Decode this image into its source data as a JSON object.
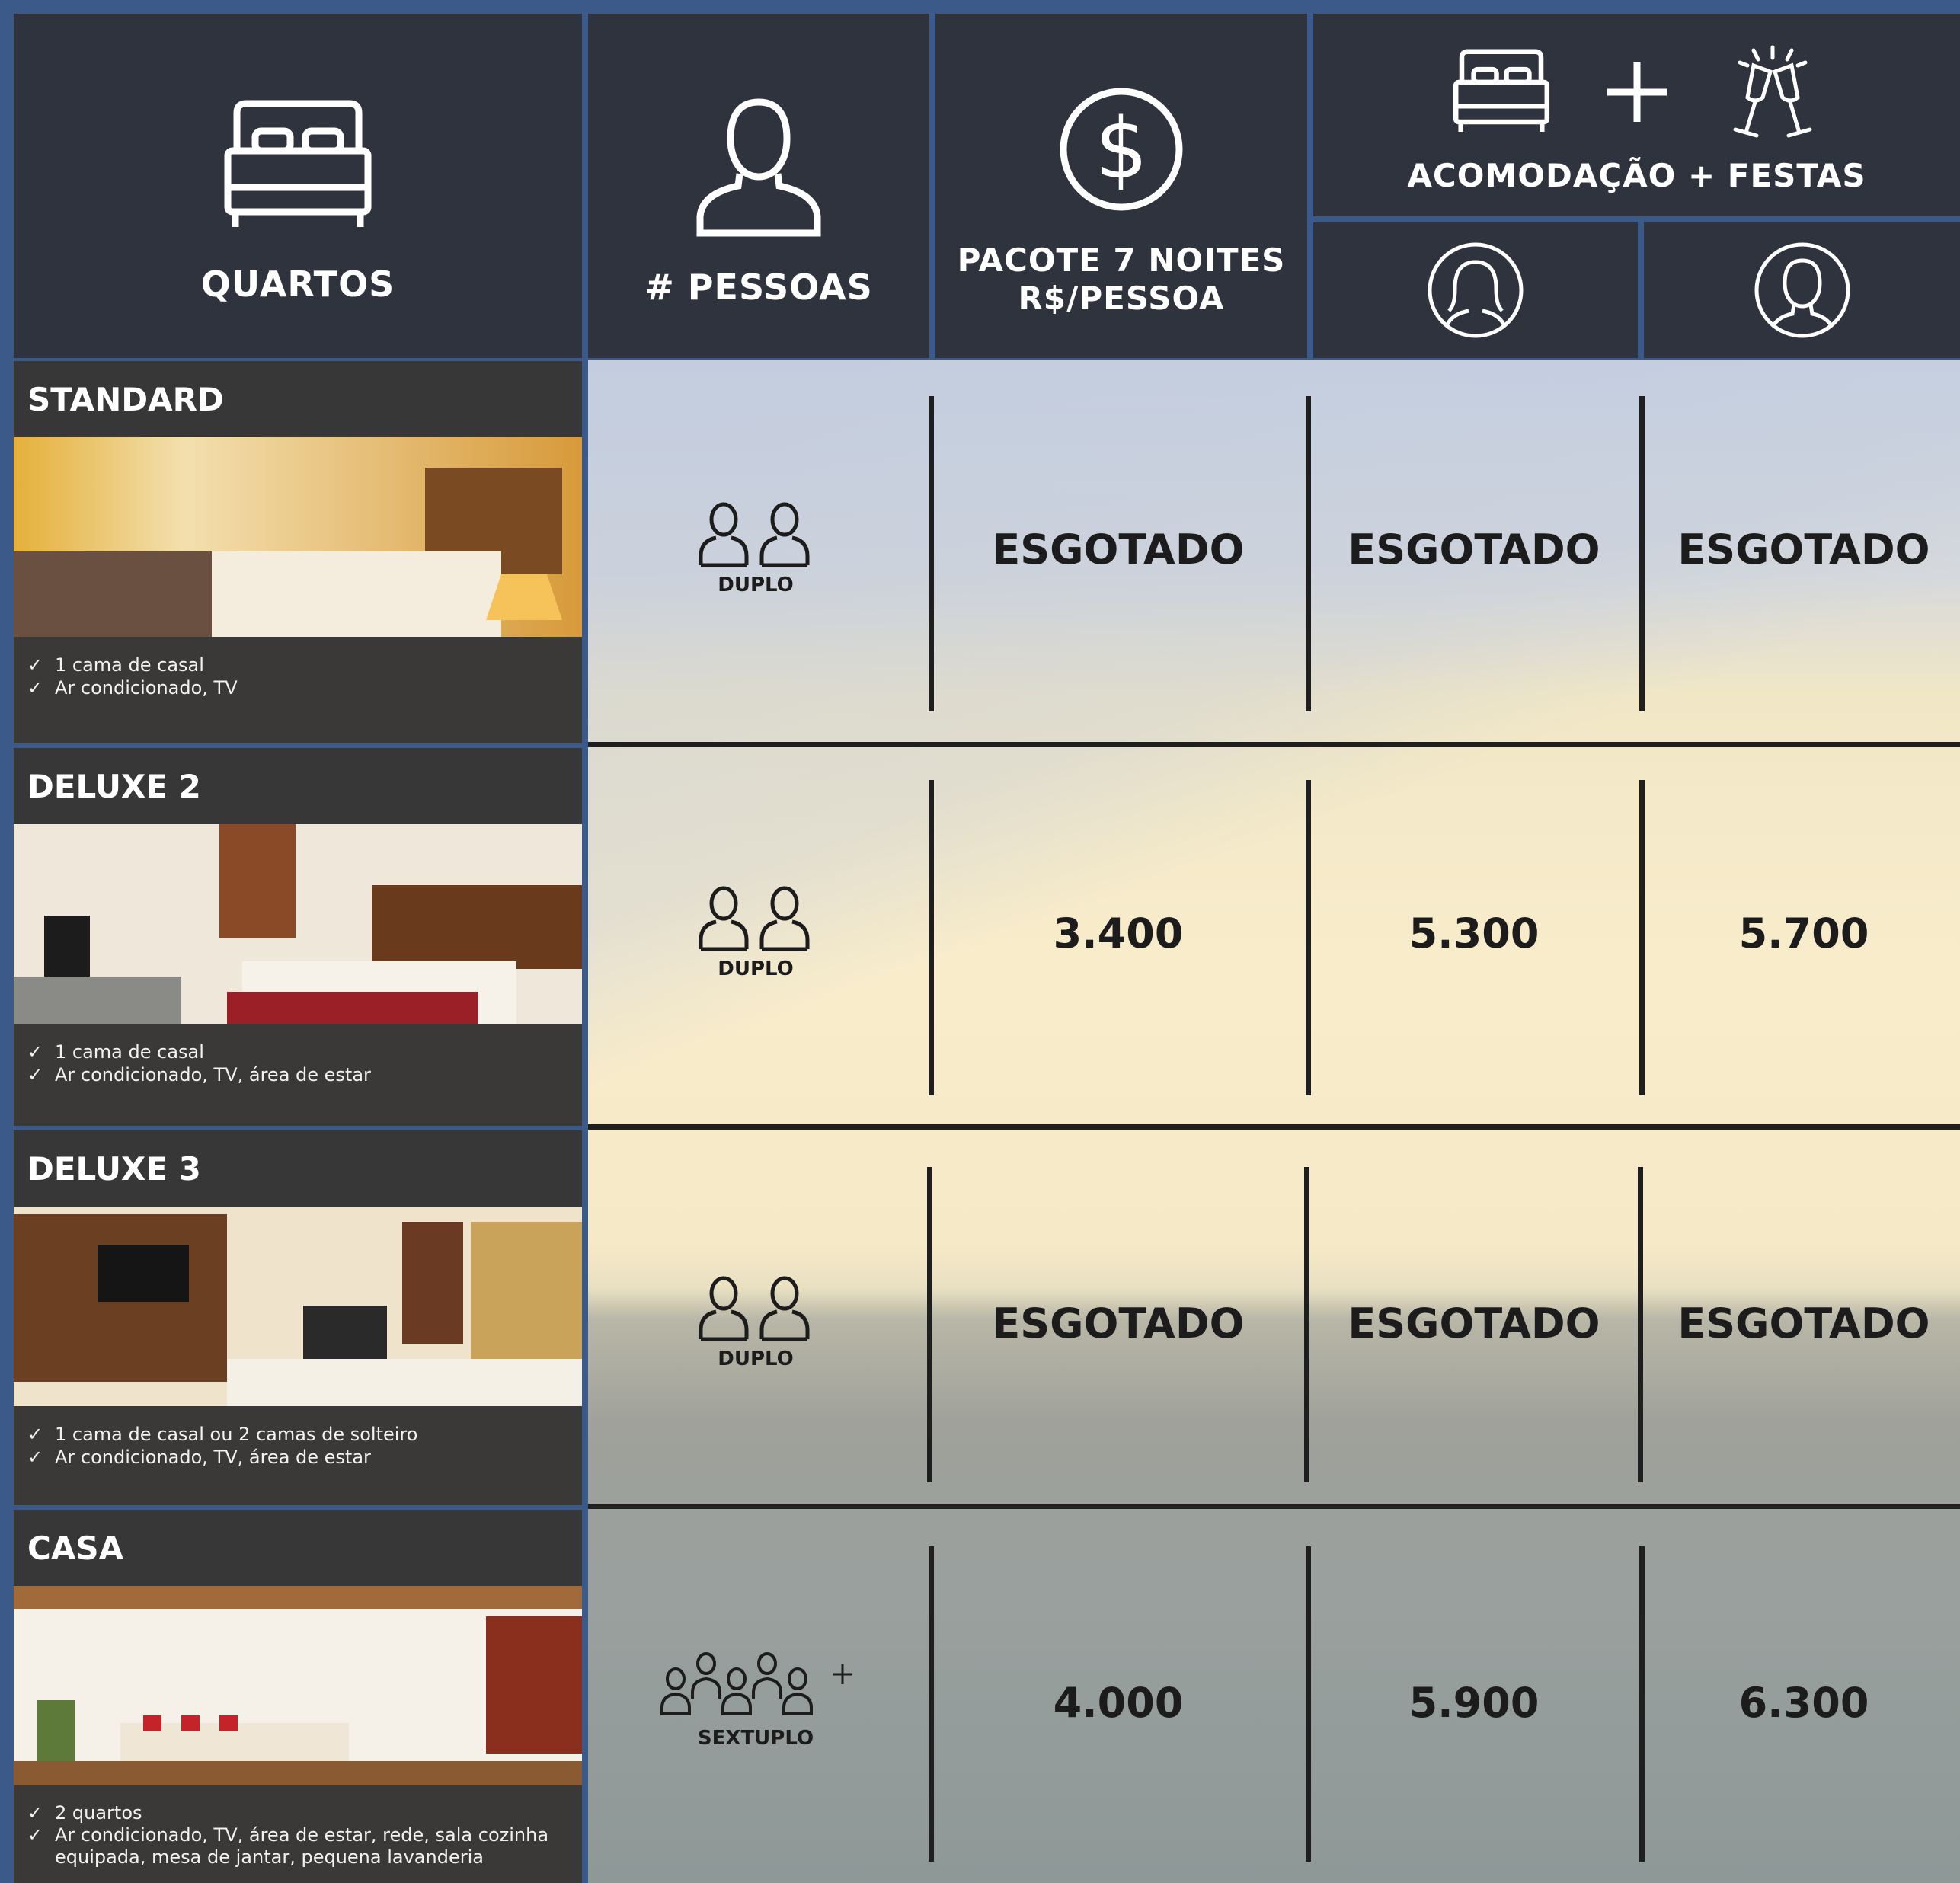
{
  "header": {
    "rooms_label": "QUARTOS",
    "people_label": "# PESSOAS",
    "package_label_line1": "PACOTE 7 NOITES",
    "package_label_line2": "R$/PESSOA",
    "combo_label": "ACOMODAÇÃO + FESTAS",
    "icons": [
      "bed-icon",
      "person-icon",
      "dollar-icon",
      "bed-icon",
      "plus-icon",
      "champagne-icon",
      "female-avatar-icon",
      "male-avatar-icon"
    ]
  },
  "rooms": [
    {
      "name": "STANDARD",
      "features": [
        "1 cama de casal",
        "Ar condicionado, TV"
      ],
      "occupancy": "DUPLO",
      "price_package": "ESGOTADO",
      "price_female": "ESGOTADO",
      "price_male": "ESGOTADO"
    },
    {
      "name": "DELUXE 2",
      "features": [
        "1 cama de casal",
        "Ar condicionado, TV, área de estar"
      ],
      "occupancy": "DUPLO",
      "price_package": "3.400",
      "price_female": "5.300",
      "price_male": "5.700"
    },
    {
      "name": "DELUXE 3",
      "features": [
        "1 cama de casal ou 2 camas de solteiro",
        "Ar condicionado, TV, área de estar"
      ],
      "occupancy": "DUPLO",
      "price_package": "ESGOTADO",
      "price_female": "ESGOTADO",
      "price_male": "ESGOTADO"
    },
    {
      "name": "CASA",
      "features": [
        "2 quartos",
        "Ar condicionado, TV, área de estar, rede, sala cozinha",
        "equipada, mesa de jantar, pequena lavanderia"
      ],
      "occupancy": "SEXTUPLO",
      "price_package": "4.000",
      "price_female": "5.900",
      "price_male": "6.300"
    }
  ],
  "check_mark": "✓"
}
